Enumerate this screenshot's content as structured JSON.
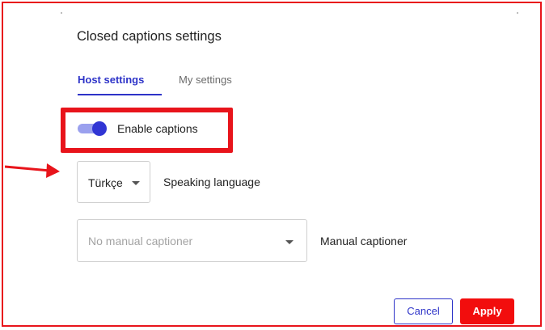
{
  "dialog": {
    "title": "Closed captions settings"
  },
  "tabs": [
    {
      "label": "Host settings",
      "active": true
    },
    {
      "label": "My settings",
      "active": false
    }
  ],
  "captions_toggle": {
    "label": "Enable captions",
    "enabled": true
  },
  "speaking_language": {
    "value": "Türkçe",
    "label": "Speaking language"
  },
  "manual_captioner": {
    "placeholder": "No manual captioner",
    "label": "Manual captioner"
  },
  "buttons": {
    "cancel": "Cancel",
    "apply": "Apply"
  },
  "colors": {
    "accent": "#2d33c8",
    "annotation_red": "#e8141b",
    "apply_button": "#f20d0d",
    "toggle_track": "#9aa0ee",
    "toggle_thumb": "#3035d4"
  },
  "icons": {
    "toggle": "toggle-switch-on-icon",
    "dropdown": "chevron-down-icon",
    "annotation": "red-arrow-icon"
  }
}
